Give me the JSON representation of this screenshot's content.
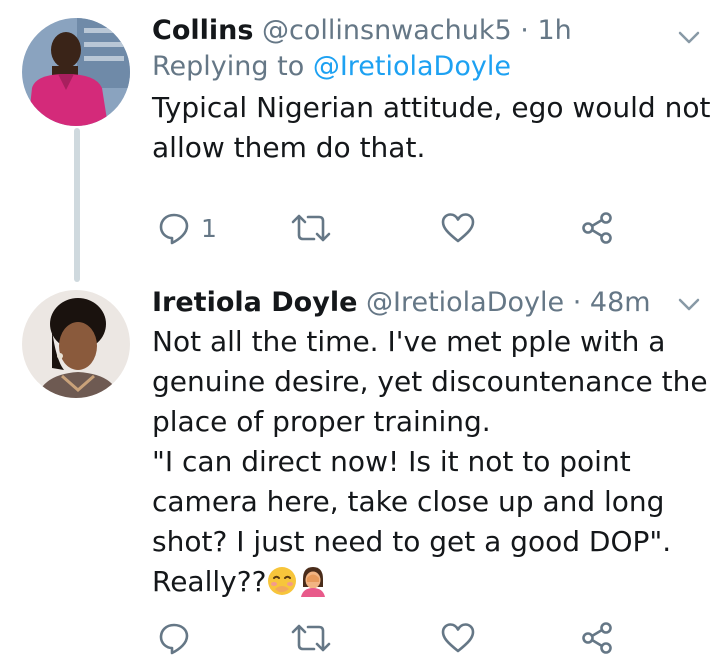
{
  "tweets": [
    {
      "display_name": "Collins",
      "handle": "@collinsnwachuk5",
      "sep": "·",
      "time": "1h",
      "replying_prefix": "Replying to",
      "replying_to": "@IretiolaDoyle",
      "lines": [
        "Typical Nigerian attitude, ego would not",
        "allow them do that."
      ],
      "reply_count": "1"
    },
    {
      "display_name": "Iretiola Doyle",
      "handle": "@IretiolaDoyle",
      "sep": "·",
      "time": "48m",
      "lines": [
        "Not all the time. I've met pple with a",
        "genuine desire, yet discountenance the",
        "place of  proper training.",
        "\"I can direct now! Is it not to point",
        "camera here, take close up and long",
        "shot? I just need to get a good DOP\".",
        "Really??"
      ],
      "emojis": [
        "smiling-face-with-hand-over-mouth",
        "person-facepalming"
      ]
    }
  ],
  "icons": {
    "reply": "reply-icon",
    "retweet": "retweet-icon",
    "like": "heart-icon",
    "share": "share-icon",
    "menu": "chevron-down-icon"
  },
  "colors": {
    "text": "#14171a",
    "muted": "#657786",
    "link": "#1da1f2",
    "thread_line": "#cfd9de"
  }
}
